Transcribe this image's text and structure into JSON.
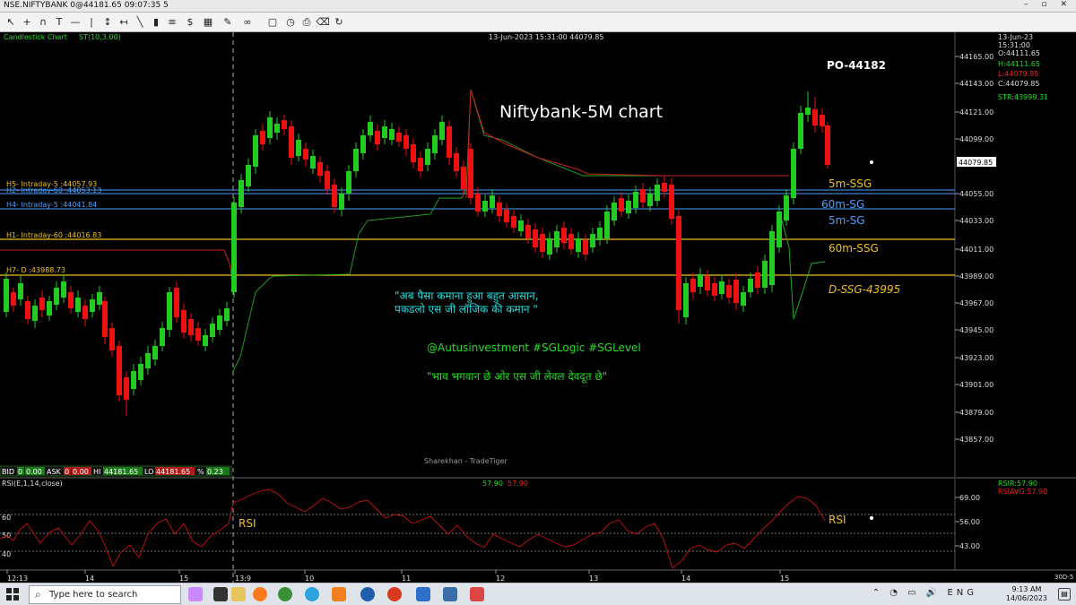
{
  "window": {
    "title": "NSE.NIFTYBANK 0@44181.65 09:07:35 5",
    "controls": "– ▫ ✕"
  },
  "chart": {
    "chart_kind_label": "Candlestick Chart",
    "indicator_label": "ST(10,3.00)",
    "cursor_info": "13-Jun-2023 15:31:00 44079.85",
    "heading": "Niftybank-5M chart",
    "po_label": "PO-44182",
    "watermark": "Sharekhan - TradeTiger",
    "quote_panel": {
      "date": "13-Jun-23",
      "time": "15:31:00",
      "open": "O:44111.65",
      "high": "H:44111.65",
      "low": "L:44079.85",
      "close": "C:44079.85",
      "str": "STR:43999.31"
    },
    "price_axis": [
      "44165.00",
      "44143.00",
      "44121.00",
      "44099.00",
      "44055.00",
      "44033.00",
      "44011.00",
      "43989.00",
      "43967.00",
      "43945.00",
      "43923.00",
      "43901.00",
      "43879.00",
      "43857.00"
    ],
    "last_price_tag": "44079.85",
    "levels": [
      {
        "label": "H5- Intraday-5 :44057.93",
        "tag": "5m-SSG",
        "color": "#4aa0ff",
        "tagcolor": "#f0c020"
      },
      {
        "label": "H2- Intraday-60 :44053.13",
        "tag": "60m-SSG",
        "color": "#4aa0ff",
        "tagcolor": "#4aa0ff"
      },
      {
        "label": "H4- Intraday-5 :44041.84",
        "tag": "5m-SG",
        "color": "#4aa0ff",
        "tagcolor": "#4aa0ff"
      },
      {
        "label": "H1- Intraday-60 :44016.83",
        "tag": "60m-SSG",
        "color": "#f0c020",
        "tagcolor": "#f0c020"
      },
      {
        "label": "H7- D :43988.73",
        "tag": "D-SSG-43995",
        "color": "#f0c020",
        "tagcolor": "#f0c020"
      }
    ],
    "hindi_line1": "\"अब पैसा कमाना हुआ बहुत आसान,",
    "hindi_line2": "पकडलो एस जी लॉजिक की कमान \"",
    "hashtags": "@Autusinvestment  #SGLogic  #SGLevel",
    "hindi_quote": "\"भाव भगवान छे ओर एस जी लेवल देवदूत छे\"",
    "status_bar": {
      "bid_label": "BID",
      "bid_qty": "0",
      "bid_val": "0.00",
      "ask_label": "ASK",
      "ask_qty": "0",
      "ask_val": "0.00",
      "hi_label": "HI",
      "hi_val": "44181.65",
      "lo_label": "LO",
      "lo_val": "44181.65",
      "pct_label": "%",
      "pct_val": "0.23"
    }
  },
  "rsi": {
    "label": "RSI(E,1,14,close)",
    "values_a": "57.90",
    "values_b": "57.90",
    "rsir": "RSIR:57.90",
    "rsiavg": "RSIAVG:57.90",
    "axis_right": [
      "69.00",
      "56.00",
      "43.00"
    ],
    "axis_left": [
      "60",
      "50",
      "40"
    ],
    "tag": "RSI",
    "tag2": "RSI"
  },
  "time_axis": [
    "12:13",
    "14",
    "15",
    "13:9",
    "10",
    "11",
    "12",
    "13",
    "14",
    "15"
  ],
  "corner_label": "30D-5",
  "taskbar": {
    "search_placeholder": "Type here to search",
    "time": "9:13 AM",
    "date": "14/06/2023"
  },
  "colors": {
    "bull": "#22cc22",
    "bear": "#ee1111",
    "supertrend_red": "#cc2222",
    "supertrend_green": "#22aa22",
    "cyan_text": "#20e0e0",
    "green_text": "#22dd22"
  },
  "chart_data": {
    "type": "candlestick",
    "ylim": [
      43840,
      44180
    ],
    "rsi_ylim": [
      35,
      75
    ],
    "supertrend": {
      "red_end": [
        44020,
        44020,
        44020,
        44020,
        44020,
        44020,
        44015
      ],
      "green_start": [
        43920,
        43960,
        43990,
        43993,
        44000,
        44035,
        44045,
        44050
      ]
    }
  }
}
